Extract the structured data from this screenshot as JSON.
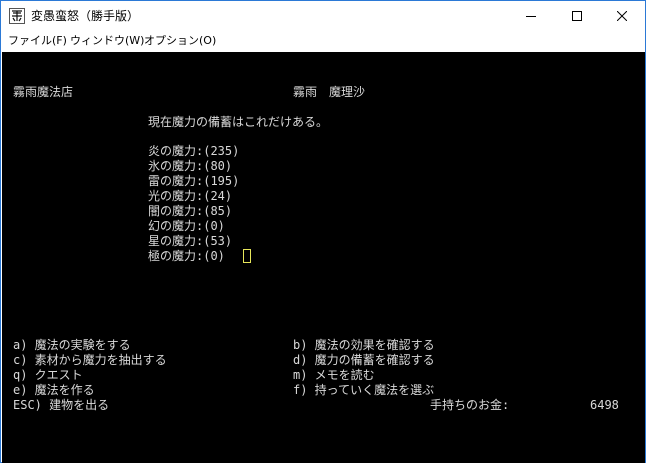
{
  "window": {
    "title": "変愚蛮怒（勝手版）",
    "controls": {
      "minimize": "minimize",
      "maximize": "maximize",
      "close": "close"
    }
  },
  "menubar": [
    {
      "label": "ファイル(F)"
    },
    {
      "label": "ウィンドウ(W)"
    },
    {
      "label": "オプション(O)"
    }
  ],
  "console": {
    "shop_name": "霧雨魔法店",
    "owner_name": "霧雨　魔理沙",
    "intro": "現在魔力の備蓄はこれだけある。",
    "mana": [
      {
        "text": "炎の魔力:(235)"
      },
      {
        "text": "氷の魔力:(80)"
      },
      {
        "text": "雷の魔力:(195)"
      },
      {
        "text": "光の魔力:(24)"
      },
      {
        "text": "闇の魔力:(85)"
      },
      {
        "text": "幻の魔力:(0)"
      },
      {
        "text": "星の魔力:(53)"
      },
      {
        "text": "極の魔力:(0)"
      }
    ],
    "options": {
      "a": "a) 魔法の実験をする",
      "b": "b) 魔法の効果を確認する",
      "c": "c) 素材から魔力を抽出する",
      "d": "d) 魔力の備蓄を確認する",
      "q": "q) クエスト",
      "m": "m) メモを読む",
      "e": "e) 魔法を作る",
      "f": "f) 持っていく魔法を選ぶ",
      "esc": "ESC) 建物を出る"
    },
    "gold_label": "手持ちのお金:",
    "gold_value": "6498",
    "text_color": "#d9d9d9",
    "cursor_color": "#e7e65a"
  }
}
